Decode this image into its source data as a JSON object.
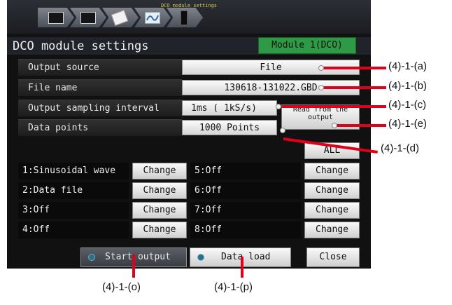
{
  "header": {
    "caption": "DCO module settings",
    "nav_icons": [
      "module-icon",
      "display-icon",
      "document-icon",
      "signal-icon",
      "memory-icon"
    ]
  },
  "title": {
    "text": "DCO module settings",
    "module": "Module  1(DCO)"
  },
  "settings": {
    "output_source": {
      "label": "Output source",
      "value": "File"
    },
    "file_name": {
      "label": "File name",
      "value": "130618-131022.GBD"
    },
    "sampling_interval": {
      "label": "Output sampling interval",
      "value": "1ms  (  1kS/s)"
    },
    "data_points": {
      "label": "Data points",
      "value": "1000 Points"
    },
    "read_button": {
      "line1": "Read from the",
      "line2": "output"
    }
  },
  "all_button": "ALL",
  "channels": [
    {
      "label": "1:Sinusoidal wave",
      "button": "Change"
    },
    {
      "label": "2:Data file",
      "button": "Change"
    },
    {
      "label": "3:Off",
      "button": "Change"
    },
    {
      "label": "4:Off",
      "button": "Change"
    },
    {
      "label": "5:Off",
      "button": "Change"
    },
    {
      "label": "6:Off",
      "button": "Change"
    },
    {
      "label": "7:Off",
      "button": "Change"
    },
    {
      "label": "8:Off",
      "button": "Change"
    }
  ],
  "footer": {
    "start_output": "Start output",
    "data_load": "Data load",
    "close": "Close"
  },
  "callouts": {
    "a": "(4)-1-(a)",
    "b": "(4)-1-(b)",
    "c": "(4)-1-(c)",
    "e": "(4)-1-(e)",
    "d": "(4)-1-(d)",
    "o": "(4)-1-(o)",
    "p": "(4)-1-(p)"
  },
  "colors": {
    "screen_bg": "#111111",
    "module_badge": "#2f9a46",
    "leader_line": "#e0001a"
  }
}
